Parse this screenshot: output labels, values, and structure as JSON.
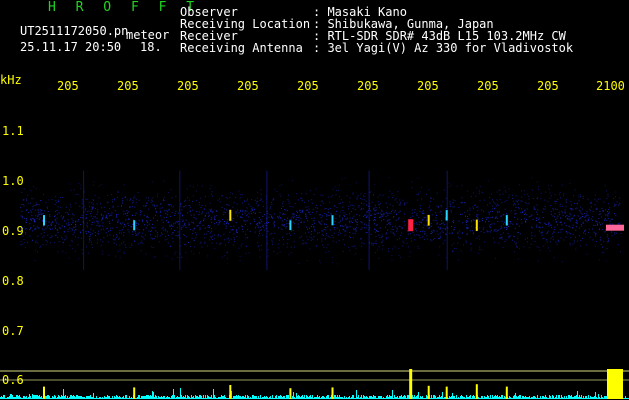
{
  "header": {
    "brand": "H R O F F T",
    "file_name": "UT2511172050.pn",
    "meteor_label": "meteor",
    "datetime": "25.11.17 20:50",
    "meteor_count": "18.",
    "info_labels": [
      "Observer",
      "Receiving Location",
      "Receiver",
      "Receiving Antenna"
    ],
    "info_values": [
      ": Masaki Kano",
      ": Shibukawa, Gunma, Japan",
      ": RTL-SDR SDR# 43dB L15 103.2MHz CW",
      ": 3el Yagi(V) Az 330 for Vladivostok"
    ]
  },
  "chart_data": {
    "type": "heatmap",
    "title": "",
    "ylabel": "kHz",
    "y_unit": "kHz",
    "ylim": [
      0.6,
      1.2
    ],
    "y_ticks": [
      "1.1",
      "1.0",
      "0.9",
      "0.8",
      "0.7",
      "0.6"
    ],
    "x_ticks": [
      "205",
      "205",
      "205",
      "205",
      "205",
      "205",
      "205",
      "205",
      "205",
      "2100"
    ],
    "x_range": [
      "20:50",
      "21:00"
    ],
    "echo_band_khz": [
      0.82,
      1.02
    ],
    "echoes": [
      {
        "minute": 0.4,
        "khz": 0.92,
        "strength": 0.4
      },
      {
        "minute": 1.9,
        "khz": 0.91,
        "strength": 0.35
      },
      {
        "minute": 3.5,
        "khz": 0.93,
        "strength": 0.5
      },
      {
        "minute": 4.5,
        "khz": 0.91,
        "strength": 0.3
      },
      {
        "minute": 5.2,
        "khz": 0.92,
        "strength": 0.35
      },
      {
        "minute": 6.5,
        "khz": 0.91,
        "strength": 0.9
      },
      {
        "minute": 6.8,
        "khz": 0.92,
        "strength": 0.45
      },
      {
        "minute": 7.1,
        "khz": 0.93,
        "strength": 0.4
      },
      {
        "minute": 7.6,
        "khz": 0.91,
        "strength": 0.55
      },
      {
        "minute": 8.1,
        "khz": 0.92,
        "strength": 0.4
      },
      {
        "minute": 9.9,
        "khz": 0.905,
        "strength": 1.0
      }
    ],
    "colors": {
      "noise": "#1a2ad6",
      "echo_weak": "#29d6ff",
      "echo_mid": "#ffe400",
      "echo_strong": "#ff2244",
      "echo_strongest": "#ff6699",
      "activity_trace": "#00ffff",
      "activity_peak": "#ffff00",
      "guide_line": "#ffff99"
    }
  }
}
